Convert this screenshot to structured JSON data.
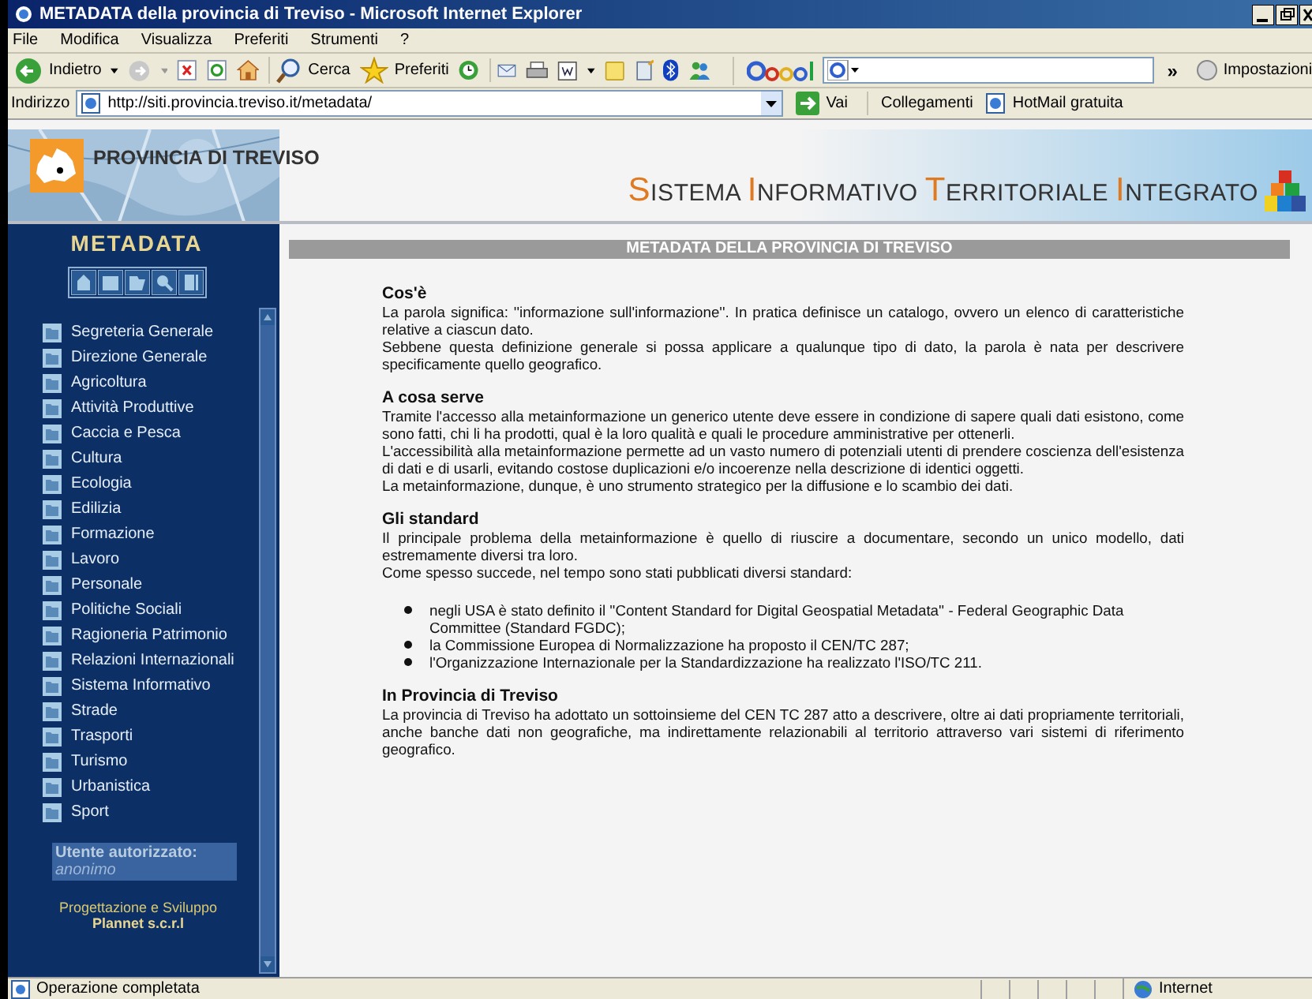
{
  "window": {
    "title": "METADATA della provincia di Treviso - Microsoft Internet Explorer"
  },
  "menu": [
    "File",
    "Modifica",
    "Visualizza",
    "Preferiti",
    "Strumenti",
    "?"
  ],
  "toolbar": {
    "back": "Indietro",
    "search": "Cerca",
    "favorites": "Preferiti",
    "google_more": "»",
    "settings": "Impostazioni"
  },
  "address_bar": {
    "label": "Indirizzo",
    "url": "http://siti.provincia.treviso.it/metadata/",
    "go": "Vai",
    "links_label": "Collegamenti",
    "link": "HotMail gratuita"
  },
  "header": {
    "logo_text": "PROVINCIA DI TREVISO",
    "site_title": "SISTEMA INFORMATIVO TERRITORIALE INTEGRATO"
  },
  "sidebar": {
    "title": "METADATA",
    "items": [
      "Segreteria Generale",
      "Direzione Generale",
      "Agricoltura",
      "Attività Produttive",
      "Caccia e Pesca",
      "Cultura",
      "Ecologia",
      "Edilizia",
      "Formazione",
      "Lavoro",
      "Personale",
      "Politiche Sociali",
      "Ragioneria Patrimonio",
      "Relazioni Internazionali",
      "Sistema Informativo",
      "Strade",
      "Trasporti",
      "Turismo",
      "Urbanistica",
      "Sport"
    ],
    "user_label": "Utente autorizzato:",
    "user_name": "anonimo",
    "credits": "Progettazione e Sviluppo",
    "company": "Plannet s.c.r.l"
  },
  "content": {
    "heading": "METADATA DELLA PROVINCIA DI TREVISO",
    "sections": [
      {
        "title": "Cos'è",
        "blocks": [
          {
            "kind": "text",
            "text": "La parola significa: ''informazione sull'informazione''. In pratica definisce un catalogo, ovvero un elenco di caratteristiche relative a ciascun dato."
          },
          {
            "kind": "text",
            "text": "Sebbene questa definizione generale si possa applicare a qualunque tipo di dato, la parola è nata per descrivere specificamente quello geografico."
          }
        ]
      },
      {
        "title": "A cosa serve",
        "blocks": [
          {
            "kind": "text",
            "text": "Tramite l'accesso alla metainformazione un generico utente deve essere in condizione di sapere quali dati esistono, come sono fatti, chi li ha prodotti, qual è la loro qualità e quali le procedure amministrative per ottenerli."
          },
          {
            "kind": "text",
            "text": "L'accessibilità alla metainformazione permette ad un vasto numero di potenziali utenti di prendere coscienza dell'esistenza di dati e di usarli, evitando costose duplicazioni e/o incoerenze nella descrizione di identici oggetti."
          },
          {
            "kind": "text",
            "text": "La metainformazione, dunque, è uno strumento strategico per la diffusione e lo scambio dei dati."
          }
        ]
      },
      {
        "title": "Gli standard",
        "blocks": [
          {
            "kind": "text",
            "text": "Il principale problema della metainformazione è quello di riuscire a documentare, secondo un unico modello, dati estremamente diversi tra loro."
          },
          {
            "kind": "text",
            "text": "Come spesso succede, nel tempo sono stati pubblicati diversi standard:"
          },
          {
            "kind": "list",
            "items": [
              "negli USA è stato definito il ''Content Standard for Digital Geospatial Metadata'' - Federal Geographic Data Committee (Standard FGDC);",
              "la Commissione Europea di Normalizzazione ha proposto il CEN/TC 287;",
              "l'Organizzazione Internazionale per la Standardizzazione ha realizzato l'ISO/TC 211."
            ]
          }
        ]
      },
      {
        "title": "In Provincia di Treviso",
        "blocks": [
          {
            "kind": "text",
            "text": "La provincia di Treviso ha adottato un sottoinsieme del CEN TC 287 atto a descrivere, oltre ai dati propriamente territoriali, anche banche dati non geografiche, ma indirettamente relazionabili al territorio attraverso vari sistemi di riferimento geografico."
          }
        ]
      }
    ]
  },
  "status_bar": {
    "message": "Operazione completata",
    "zone": "Internet"
  }
}
